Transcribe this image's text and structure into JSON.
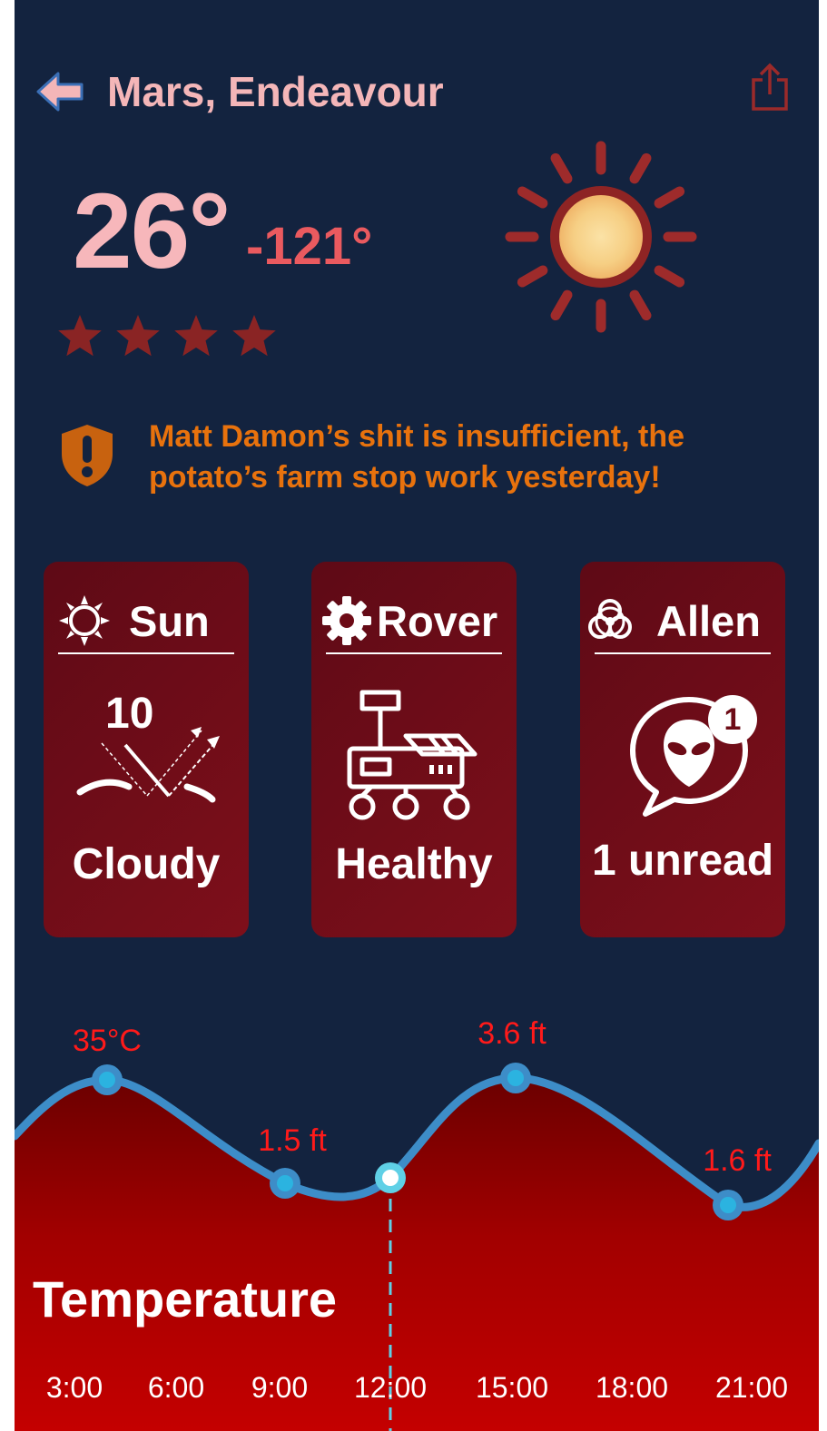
{
  "header": {
    "title": "Mars, Endeavour",
    "back_icon": "arrow-left-icon",
    "share_icon": "share-icon"
  },
  "weather": {
    "temp_high": "26°",
    "temp_low": "-121°",
    "rating": 4,
    "icon": "sun-icon"
  },
  "alert": {
    "icon": "shield-alert-icon",
    "text": "Matt Damon’s shit is insufficient, the potato’s farm stop work yesterday!"
  },
  "cards": [
    {
      "title": "Sun",
      "head_icon": "sun-icon",
      "body_icon": "sun-angle-icon",
      "count": "10",
      "status": "Cloudy"
    },
    {
      "title": "Rover",
      "head_icon": "gear-icon",
      "body_icon": "rover-icon",
      "status": "Healthy"
    },
    {
      "title": "Allen",
      "head_icon": "biohazard-icon",
      "body_icon": "alien-chat-icon",
      "badge": "1",
      "status": "1 unread"
    }
  ],
  "colors": {
    "background": "#13233f",
    "title": "#f4b6b8",
    "temp_high": "#f7b7bb",
    "temp_low": "#ea5a5f",
    "star": "#8a2424",
    "alert": "#e8720d",
    "card": "#6d0b16",
    "chart_line": "#3d8dc8",
    "chart_area": "#b00000",
    "data_label": "#ff1a1a"
  },
  "chart_data": {
    "type": "area",
    "title": "Temperature",
    "x": [
      "3:00",
      "6:00",
      "9:00",
      "12:00",
      "15:00",
      "18:00",
      "21:00"
    ],
    "annotations": [
      {
        "x": "3:00",
        "label": "35°C"
      },
      {
        "x": "9:00",
        "label": "1.5 ft"
      },
      {
        "x": "15:00",
        "label": "3.6 ft"
      },
      {
        "x": "21:00",
        "label": "1.6 ft"
      }
    ],
    "current_x": "12:00",
    "grid": false
  }
}
